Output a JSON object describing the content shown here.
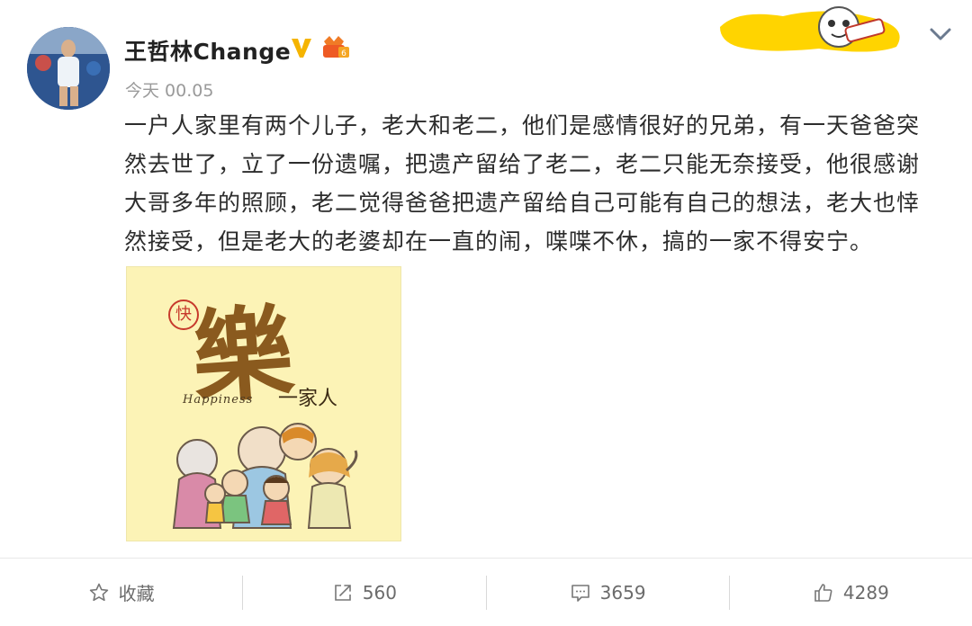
{
  "header": {
    "username": "王哲林Change",
    "timestamp": "今天 00.05",
    "icons": [
      "verified-v-icon",
      "member-badge-icon",
      "chevron-down-icon"
    ],
    "colors": {
      "verify": "#f5b400",
      "member": "#f07b26",
      "deco": "#ffd400"
    }
  },
  "post": {
    "text": "一户人家里有两个儿子，老大和老二，他们是感情很好的兄弟，有一天爸爸突然去世了，立了一份遗嘱，把遗产留给了老二，老二只能无奈接受，他很感谢大哥多年的照顾，老二觉得爸爸把遗产留给自己可能有自己的想法，老大也悻然接受，但是老大的老婆却在一直的闹，喋喋不休，搞的一家不得安宁。",
    "image": {
      "main_char": "樂",
      "seal": "快",
      "english": "Happiness",
      "family": "一家人",
      "background": "#fcf3b6"
    }
  },
  "actions": [
    {
      "icon": "star-icon",
      "label": "收藏"
    },
    {
      "icon": "share-icon",
      "label": "560"
    },
    {
      "icon": "comment-icon",
      "label": "3659"
    },
    {
      "icon": "thumbs-up-icon",
      "label": "4289"
    }
  ]
}
